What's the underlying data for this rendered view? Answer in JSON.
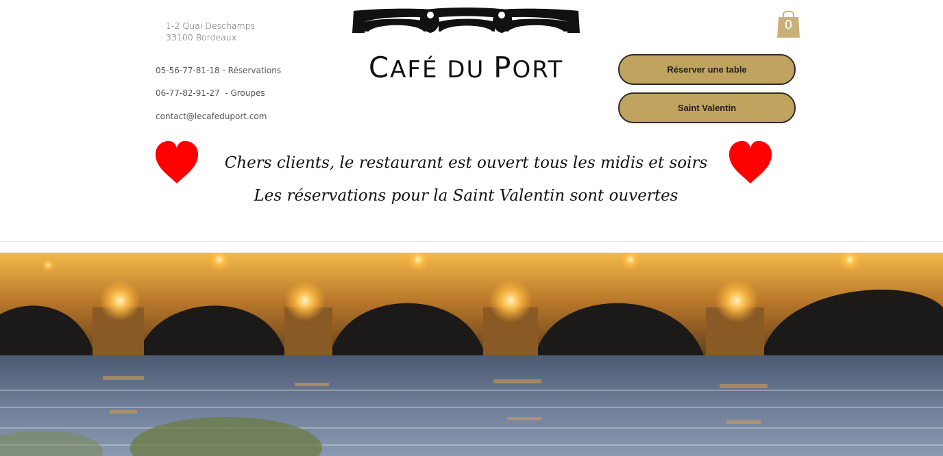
{
  "header": {
    "address": {
      "line1": "1-2 Quai Deschamps",
      "line2": "33100 Bordeaux"
    },
    "contacts": [
      "05-56-77-81-18 - Réservations",
      "06-77-82-91-27  - Groupes",
      "contact@lecafeduport.com"
    ],
    "logo": {
      "icon": "glasses-logo-icon",
      "title_parts": [
        "C",
        "AFÉ DU ",
        "P",
        "ORT"
      ]
    },
    "cart": {
      "icon": "shopping-bag-icon",
      "count": "0"
    },
    "buttons": {
      "reserve": "Réserver une table",
      "valentine": "Saint Valentin"
    }
  },
  "announcement": {
    "line1": "Chers clients, le restaurant est ouvert tous les midis et soirs",
    "line2": "Les réservations pour la Saint Valentin sont ouvertes",
    "icon": "heart-icon"
  },
  "hero": {
    "image": "illuminated-stone-bridge-over-river-at-night"
  },
  "colors": {
    "gold": "#c0a35e",
    "heart": "#ff0000",
    "text": "#111111"
  }
}
